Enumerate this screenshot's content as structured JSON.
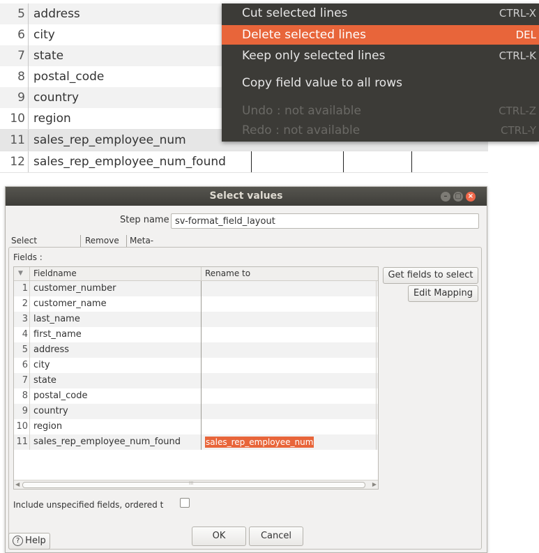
{
  "background_grid": {
    "rows": [
      {
        "num": "5",
        "name": "address"
      },
      {
        "num": "6",
        "name": "city"
      },
      {
        "num": "7",
        "name": "state"
      },
      {
        "num": "8",
        "name": "postal_code"
      },
      {
        "num": "9",
        "name": "country"
      },
      {
        "num": "10",
        "name": "region"
      },
      {
        "num": "11",
        "name": "sales_rep_employee_num"
      },
      {
        "num": "12",
        "name": "sales_rep_employee_num_found"
      }
    ]
  },
  "context_menu": {
    "items": [
      {
        "label": "Cut selected lines",
        "shortcut": "CTRL-X"
      },
      {
        "label": "Delete selected lines",
        "shortcut": "DEL"
      },
      {
        "label": "Keep only selected lines",
        "shortcut": "CTRL-K"
      },
      {
        "label": "Copy field value to all rows",
        "shortcut": ""
      },
      {
        "label": "Undo : not available",
        "shortcut": "CTRL-Z"
      },
      {
        "label": "Redo : not available",
        "shortcut": "CTRL-Y"
      }
    ]
  },
  "dialog": {
    "title": "Select values",
    "step_name_label": "Step name",
    "step_name_value": "sv-format_field_layout",
    "tabs": [
      {
        "label": "Select & Alter"
      },
      {
        "label": "Remove"
      },
      {
        "label": "Meta-data"
      }
    ],
    "fields_label": "Fields :",
    "table": {
      "headers": {
        "fieldname": "Fieldname",
        "rename": "Rename to"
      },
      "rows": [
        {
          "num": "1",
          "fieldname": "customer_number",
          "rename": ""
        },
        {
          "num": "2",
          "fieldname": "customer_name",
          "rename": ""
        },
        {
          "num": "3",
          "fieldname": "last_name",
          "rename": ""
        },
        {
          "num": "4",
          "fieldname": "first_name",
          "rename": ""
        },
        {
          "num": "5",
          "fieldname": "address",
          "rename": ""
        },
        {
          "num": "6",
          "fieldname": "city",
          "rename": ""
        },
        {
          "num": "7",
          "fieldname": "state",
          "rename": ""
        },
        {
          "num": "8",
          "fieldname": "postal_code",
          "rename": ""
        },
        {
          "num": "9",
          "fieldname": "country",
          "rename": ""
        },
        {
          "num": "10",
          "fieldname": "region",
          "rename": ""
        },
        {
          "num": "11",
          "fieldname": "sales_rep_employee_num_found",
          "rename": "sales_rep_employee_num"
        }
      ],
      "scroll_mark": "III"
    },
    "get_fields_label": "Get fields to select",
    "edit_mapping_label": "Edit Mapping",
    "include_label": "Include unspecified fields, ordered t",
    "ok_label": "OK",
    "cancel_label": "Cancel",
    "help_label": "Help"
  },
  "colors": {
    "accent": "#e8653a",
    "menu_bg": "#3c3b37",
    "titlebar": "#3e3d39",
    "dialog_bg": "#f2f1f0"
  }
}
